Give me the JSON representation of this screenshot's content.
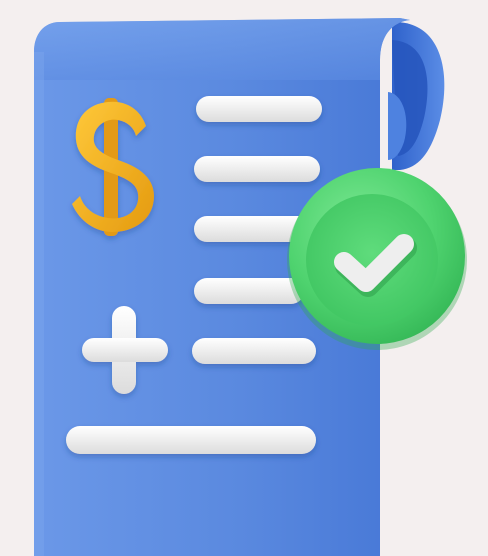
{
  "illustration": {
    "subject": "invoice-receipt-with-check",
    "icons": {
      "document": "receipt-document-icon",
      "currency": "dollar-sign-icon",
      "add": "plus-icon",
      "approved": "check-badge-icon"
    },
    "colors": {
      "background": "#f4efef",
      "paper": "#5f8fe2",
      "paper_dark": "#3f6fcf",
      "lines": "#eeeeee",
      "dollar": "#f2b01e",
      "check_badge": "#4fd36f",
      "check_mark": "#eeeeee"
    }
  }
}
